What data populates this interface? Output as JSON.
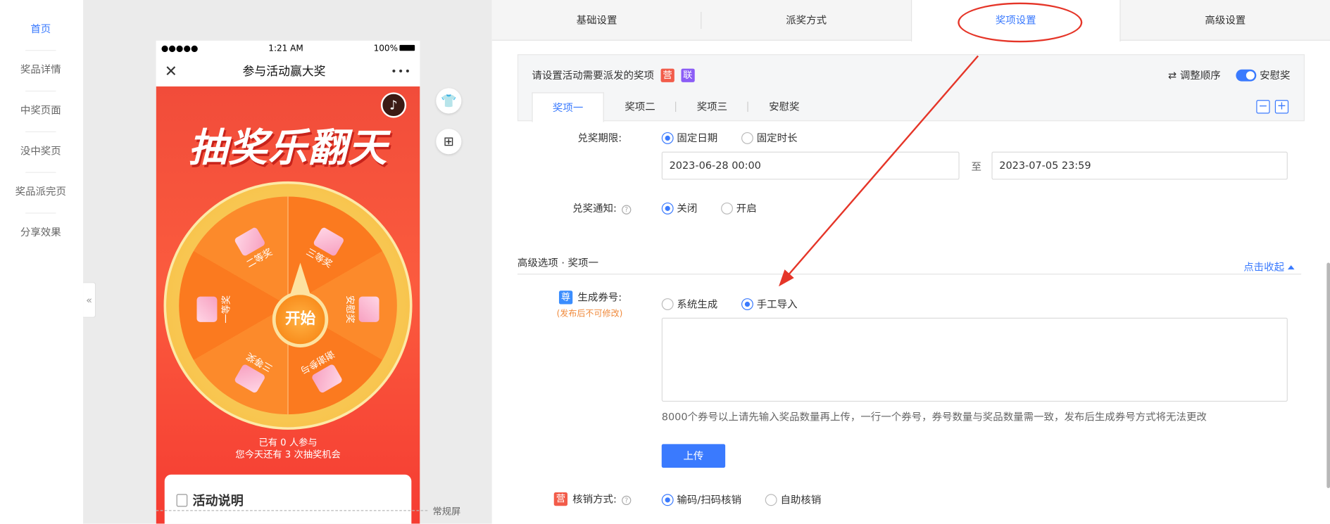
{
  "left_nav": {
    "items": [
      {
        "label": "首页",
        "active": true
      },
      {
        "label": "奖品详情",
        "active": false
      },
      {
        "label": "中奖页面",
        "active": false
      },
      {
        "label": "没中奖页",
        "active": false
      },
      {
        "label": "奖品派完页",
        "active": false
      },
      {
        "label": "分享效果",
        "active": false
      }
    ],
    "collapse_glyph": "«"
  },
  "phone": {
    "status": {
      "signal": "●●●●●",
      "time": "1:21 AM",
      "battery": "100%"
    },
    "nav_title": "参与活动赢大奖",
    "close_glyph": "✕",
    "more_glyph": "•••",
    "music_glyph": "♪",
    "poster_title": "抽奖乐翻天",
    "wheel": {
      "start_label": "开始",
      "prizes": [
        "二等奖",
        "三等奖",
        "安慰奖",
        "谢谢参与",
        "三等奖",
        "一等奖"
      ]
    },
    "join_line1": "已有 0 人参与",
    "join_line2": "您今天还有 3 次抽奖机会",
    "desc_title": "活动说明"
  },
  "side_icons": {
    "shirt": "👕",
    "grid": "⊞"
  },
  "screen_label": "常规屏",
  "tabs": [
    {
      "label": "基础设置",
      "active": false
    },
    {
      "label": "派奖方式",
      "active": false
    },
    {
      "label": "奖项设置",
      "active": true
    },
    {
      "label": "高级设置",
      "active": false
    }
  ],
  "prize_box": {
    "title": "请设置活动需要派发的奖项",
    "badge1": "营",
    "badge2": "联",
    "reorder": "⇄ 调整顺序",
    "consolation_toggle": "安慰奖",
    "sub_tabs": [
      "奖项一",
      "奖项二",
      "奖项三",
      "安慰奖"
    ],
    "minus": "−",
    "plus": "+"
  },
  "form": {
    "redeem_period_label": "兑奖期限:",
    "period_options": [
      "固定日期",
      "固定时长"
    ],
    "period_selected": "固定日期",
    "start_date": "2023-06-28 00:00",
    "to_label": "至",
    "end_date": "2023-07-05 23:59",
    "notify_label": "兑奖通知:",
    "notify_options": [
      "关闭",
      "开启"
    ],
    "notify_selected": "关闭",
    "help_glyph": "?"
  },
  "advanced": {
    "section_title": "高级选项 · 奖项一",
    "collapse_link": "点击收起",
    "coupon_badge": "尊",
    "coupon_label": "生成券号:",
    "coupon_note": "(发布后不可修改)",
    "coupon_options": [
      "系统生成",
      "手工导入"
    ],
    "coupon_selected": "手工导入",
    "textarea_value": "",
    "tip": "8000个券号以上请先输入奖品数量再上传，一行一个券号，券号数量与奖品数量需一致，发布后生成券号方式将无法更改",
    "upload_label": "上传",
    "verify_badge": "营",
    "verify_label": "核销方式:",
    "verify_options": [
      "输码/扫码核销",
      "自助核销"
    ],
    "verify_selected": "输码/扫码核销"
  },
  "annotation_color": "#e53528",
  "accent_color": "#3a7afe"
}
